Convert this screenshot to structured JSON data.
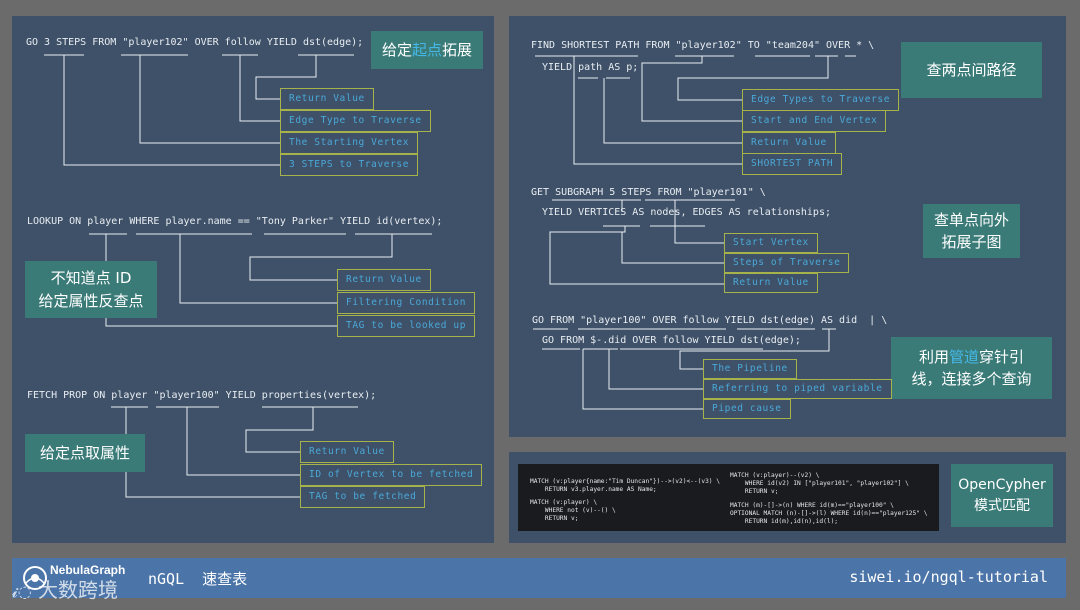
{
  "left": {
    "go": {
      "code": "GO 3 STEPS FROM \"player102\" OVER follow YIELD dst(edge);",
      "tag_prefix": "给定",
      "tag_highlight": "起点",
      "tag_suffix": "拓展",
      "labels": [
        "Return Value",
        "Edge Type to Traverse",
        "The Starting Vertex",
        "3 STEPS to Traverse"
      ]
    },
    "lookup": {
      "code": "LOOKUP ON player WHERE player.name == \"Tony Parker\" YIELD id(vertex);",
      "tag_line1": "不知道点 ID",
      "tag_line2": "给定属性反查点",
      "labels": [
        "Return Value",
        "Filtering Condition",
        "TAG to be looked up"
      ]
    },
    "fetch": {
      "code": "FETCH PROP ON player \"player100\" YIELD properties(vertex);",
      "tag": "给定点取属性",
      "labels": [
        "Return Value",
        "ID of Vertex to be fetched",
        "TAG to be fetched"
      ]
    }
  },
  "right": {
    "path": {
      "code1": "FIND SHORTEST PATH FROM \"player102\" TO \"team204\" OVER * \\",
      "code2": "YIELD path AS p;",
      "tag": "查两点间路径",
      "labels": [
        "Edge Types to Traverse",
        "Start and End Vertex",
        "Return Value",
        "SHORTEST PATH"
      ]
    },
    "subgraph": {
      "code1": "GET SUBGRAPH 5 STEPS FROM \"player101\" \\",
      "code2": "YIELD VERTICES AS nodes, EDGES AS relationships;",
      "tag_line1": "查单点向外",
      "tag_line2": "拓展子图",
      "labels": [
        "Start Vertex",
        "Steps of Traverse",
        "Return Value"
      ]
    },
    "pipe": {
      "code1": "GO FROM \"player100\" OVER follow YIELD dst(edge) AS did  | \\",
      "code2": "GO FROM $-.did OVER follow YIELD dst(edge);",
      "tag_prefix": "利用",
      "tag_highlight": "管道",
      "tag_suffix": "穿针引",
      "tag_line2": "线，连接多个查询",
      "labels": [
        "The Pipeline",
        "Referring to piped variable",
        "Piped cause"
      ]
    },
    "cypher": {
      "tag_line1": "OpenCypher",
      "tag_line2": "模式匹配",
      "left_block": [
        "MATCH (v:player{name:\"Tim Duncan\"})-->(v2)<--(v3) \\",
        "    RETURN v3.player.name AS Name;",
        "",
        "MATCH (v:player) \\",
        "    WHERE not (v)--() \\",
        "    RETURN v;"
      ],
      "right_block": [
        "MATCH (v:player)--(v2) \\",
        "    WHERE id(v2) IN [\"player101\", \"player102\"] \\",
        "    RETURN v;",
        "",
        "MATCH (m)-[]->(n) WHERE id(m)==\"player100\" \\",
        "OPTIONAL MATCH (n)-[]->(l) WHERE id(n)==\"player125\" \\",
        "    RETURN id(m),id(n),id(l);"
      ]
    }
  },
  "footer": {
    "logo": "NebulaGraph",
    "title": "nGQL  速查表",
    "link": "siwei.io/ngql-tutorial",
    "watermark": "大数跨境"
  },
  "colors": {
    "panel": "#3f5168",
    "tag": "#3a7b78",
    "label_border": "#a6b34a",
    "label_text": "#4aa8d8",
    "highlight": "#45b8e8",
    "footer": "#4b74a8"
  }
}
